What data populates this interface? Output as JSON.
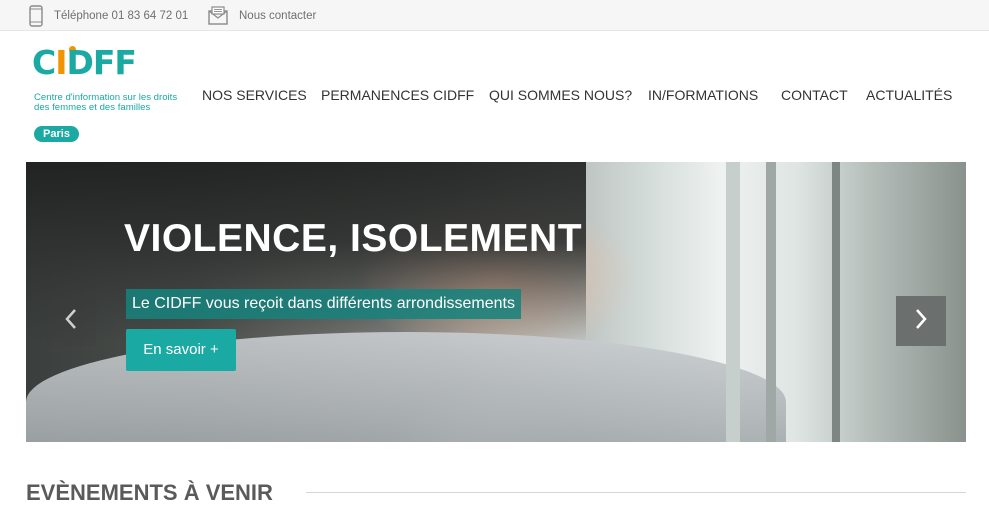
{
  "topbar": {
    "phone": {
      "icon": "phone-icon",
      "label": "Téléphone 01 83 64 72 01"
    },
    "contact": {
      "icon": "envelope-icon",
      "label": "Nous contacter"
    }
  },
  "logo": {
    "brand_pre": "C",
    "brand_i": "I",
    "brand_post": "DFF",
    "tagline": "Centre d'information sur les droits des femmes et des familles",
    "city": "Paris"
  },
  "nav": {
    "items": [
      {
        "label": "NOS SERVICES"
      },
      {
        "label": "PERMANENCES CIDFF"
      },
      {
        "label": "QUI SOMMES NOUS?"
      },
      {
        "label": "IN/FORMATIONS"
      },
      {
        "label": "CONTACT"
      },
      {
        "label": "ACTUALITÉS"
      }
    ]
  },
  "hero": {
    "title": "VIOLENCE, ISOLEMENT",
    "subtitle": "Le CIDFF vous reçoit dans différents arrondissements",
    "button": "En savoir +",
    "prev_icon": "chevron-left-icon",
    "next_icon": "chevron-right-icon"
  },
  "section": {
    "title": "EVÈNEMENTS À VENIR"
  },
  "colors": {
    "brand": "#1aa9a3",
    "accent": "#f29400",
    "text": "#333333"
  }
}
